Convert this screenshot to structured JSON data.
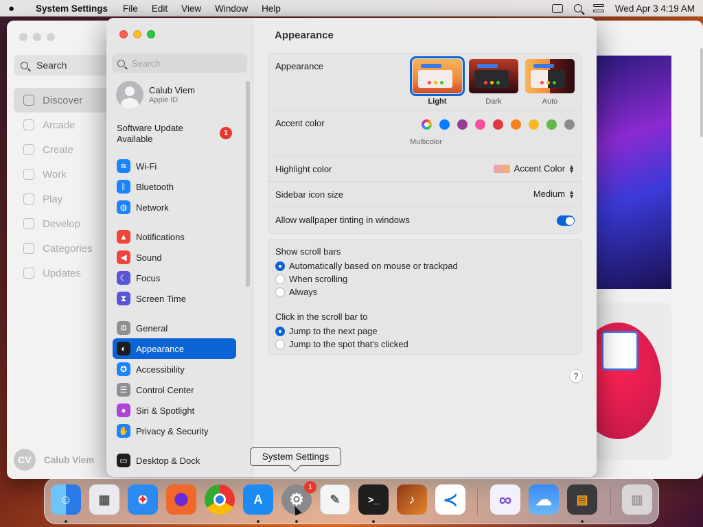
{
  "menubar": {
    "app_name": "System Settings",
    "menus": [
      "File",
      "Edit",
      "View",
      "Window",
      "Help"
    ],
    "clock": "Wed Apr 3  4:19 AM"
  },
  "background_app": {
    "search_label": "Search",
    "nav": [
      "Discover",
      "Arcade",
      "Create",
      "Work",
      "Play",
      "Develop",
      "Categories",
      "Updates"
    ],
    "user_initials": "CV",
    "user_name": "Calub Viem"
  },
  "sidebar": {
    "search_placeholder": "Search",
    "user_name": "Calub Viem",
    "user_sub": "Apple ID",
    "update_label": "Software Update Available",
    "update_count": "1",
    "groups": [
      [
        {
          "label": "Wi-Fi",
          "icon": "wifi-icon",
          "color": "#1a84ff"
        },
        {
          "label": "Bluetooth",
          "icon": "bluetooth-icon",
          "color": "#1a84ff"
        },
        {
          "label": "Network",
          "icon": "globe-icon",
          "color": "#1a84ff"
        }
      ],
      [
        {
          "label": "Notifications",
          "icon": "bell-icon",
          "color": "#f0453a"
        },
        {
          "label": "Sound",
          "icon": "speaker-icon",
          "color": "#f0453a"
        },
        {
          "label": "Focus",
          "icon": "moon-icon",
          "color": "#5856d6"
        },
        {
          "label": "Screen Time",
          "icon": "hourglass-icon",
          "color": "#5856d6"
        }
      ],
      [
        {
          "label": "General",
          "icon": "gear-icon",
          "color": "#8e8e93"
        },
        {
          "label": "Appearance",
          "icon": "appearance-icon",
          "color": "#1d1d1f"
        },
        {
          "label": "Accessibility",
          "icon": "accessibility-icon",
          "color": "#1a84ff"
        },
        {
          "label": "Control Center",
          "icon": "control-center-icon",
          "color": "#8e8e93"
        },
        {
          "label": "Siri & Spotlight",
          "icon": "siri-icon",
          "color": "#b044d8"
        },
        {
          "label": "Privacy & Security",
          "icon": "hand-icon",
          "color": "#1a84ff"
        }
      ],
      [
        {
          "label": "Desktop & Dock",
          "icon": "dock-icon",
          "color": "#1d1d1f"
        }
      ]
    ],
    "active": "Appearance"
  },
  "content": {
    "title": "Appearance",
    "appearance_label": "Appearance",
    "appearance_options": [
      "Light",
      "Dark",
      "Auto"
    ],
    "appearance_selected": "Light",
    "accent_label": "Accent color",
    "accent_colors": [
      "multicolor",
      "#0a7aff",
      "#953d96",
      "#f74f9e",
      "#e0383e",
      "#f7821b",
      "#fcb827",
      "#62ba46",
      "#8c8c8c"
    ],
    "accent_caption": "Multicolor",
    "highlight_label": "Highlight color",
    "highlight_value": "Accent Color",
    "icon_size_label": "Sidebar icon size",
    "icon_size_value": "Medium",
    "tinting_label": "Allow wallpaper tinting in windows",
    "tinting_on": true,
    "scroll_bars_title": "Show scroll bars",
    "scroll_bars_options": [
      "Automatically based on mouse or trackpad",
      "When scrolling",
      "Always"
    ],
    "scroll_bars_selected": 0,
    "click_title": "Click in the scroll bar to",
    "click_options": [
      "Jump to the next page",
      "Jump to the spot that's clicked"
    ],
    "click_selected": 0,
    "help_label": "?"
  },
  "tooltip": "System Settings",
  "dock": {
    "apps": [
      {
        "name": "finder-icon",
        "color": "#3b9cf2",
        "glyph": "☺"
      },
      {
        "name": "launchpad-icon",
        "color": "#e9e9ee",
        "glyph": "▦"
      },
      {
        "name": "safari-icon",
        "color": "#2a8af0",
        "glyph": "✦"
      },
      {
        "name": "firefox-icon",
        "color": "#f0692a",
        "glyph": "◉"
      },
      {
        "name": "chrome-icon",
        "color": "#e8e8e8",
        "glyph": "◎"
      },
      {
        "name": "app-store-icon",
        "color": "#1c8cf2",
        "glyph": "A"
      },
      {
        "name": "system-settings-icon",
        "color": "#8a8a8e",
        "glyph": "⚙"
      },
      {
        "name": "textedit-icon",
        "color": "#f4f4f4",
        "glyph": "✎"
      },
      {
        "name": "terminal-icon",
        "color": "#1e1e1e",
        "glyph": ">_"
      },
      {
        "name": "garageband-icon",
        "color": "#d86a1a",
        "glyph": "♪"
      },
      {
        "name": "vscode-icon",
        "color": "#ffffff",
        "glyph": "≺"
      },
      {
        "name": "visual-studio-icon",
        "color": "#f4f0fa",
        "glyph": "∞"
      },
      {
        "name": "weather-icon",
        "color": "#3a9af2",
        "glyph": "☁"
      },
      {
        "name": "calculator-icon",
        "color": "#3a3a3c",
        "glyph": "▤"
      },
      {
        "name": "trash-icon",
        "color": "#e6e6e6",
        "glyph": "▥"
      }
    ],
    "settings_badge": "1"
  }
}
